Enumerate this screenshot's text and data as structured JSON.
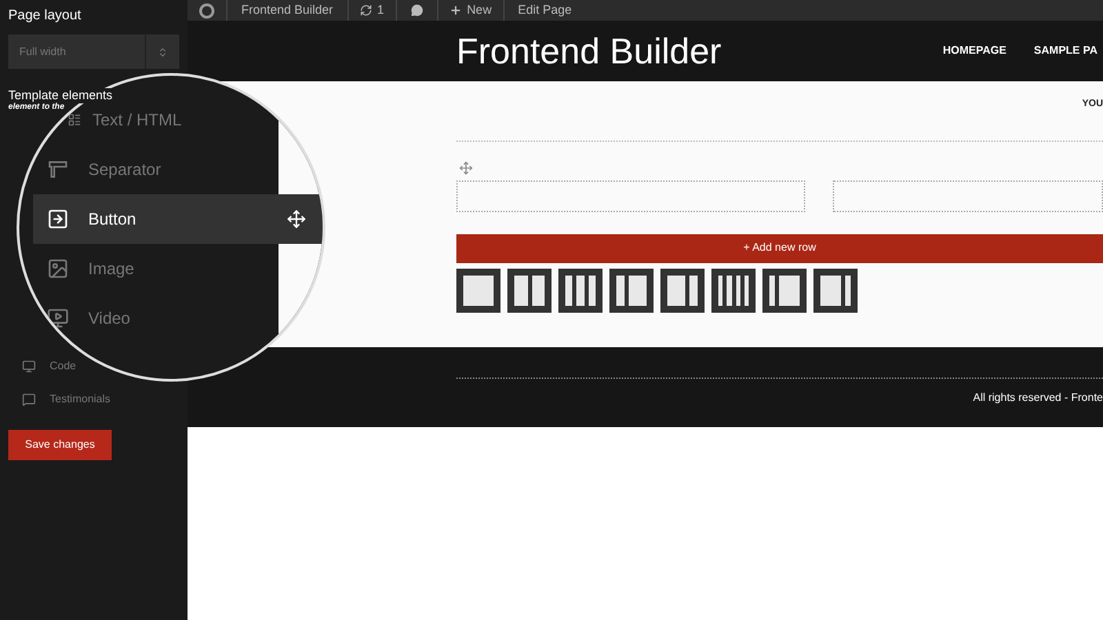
{
  "sidebar": {
    "page_layout_label": "Page layout",
    "layout_select": {
      "value": "Full width"
    },
    "template_label": "Template elements",
    "template_hint": "element to the",
    "magnified_elements": [
      {
        "kind": "text",
        "label": "Text / HTML",
        "selected": false
      },
      {
        "kind": "separator",
        "label": "Separator",
        "selected": false
      },
      {
        "kind": "button",
        "label": "Button",
        "selected": true
      },
      {
        "kind": "image",
        "label": "Image",
        "selected": false
      },
      {
        "kind": "video",
        "label": "Video",
        "selected": false
      }
    ],
    "elements": [
      {
        "kind": "code",
        "label": "Code"
      },
      {
        "kind": "testimonials",
        "label": "Testimonials"
      }
    ],
    "save_button": "Save changes"
  },
  "admin_bar": [
    {
      "kind": "logo"
    },
    {
      "kind": "text",
      "label": "Frontend Builder"
    },
    {
      "kind": "updates",
      "label": "1"
    },
    {
      "kind": "comments"
    },
    {
      "kind": "new",
      "label": "New"
    },
    {
      "kind": "text",
      "label": "Edit Page"
    }
  ],
  "site": {
    "title": "Frontend Builder",
    "nav": [
      "HOMEPAGE",
      "SAMPLE PA"
    ],
    "top_right": "YOU",
    "add_row": "+ Add new row",
    "layouts": [
      {
        "kind": "full"
      },
      {
        "kind": "halves"
      },
      {
        "kind": "thirds"
      },
      {
        "kind": "third-two-thirds"
      },
      {
        "kind": "two-thirds-third"
      },
      {
        "kind": "quarters"
      },
      {
        "kind": "quarter-rest"
      },
      {
        "kind": "rest-quarter"
      }
    ],
    "footer": "All rights reserved - Fronte"
  }
}
